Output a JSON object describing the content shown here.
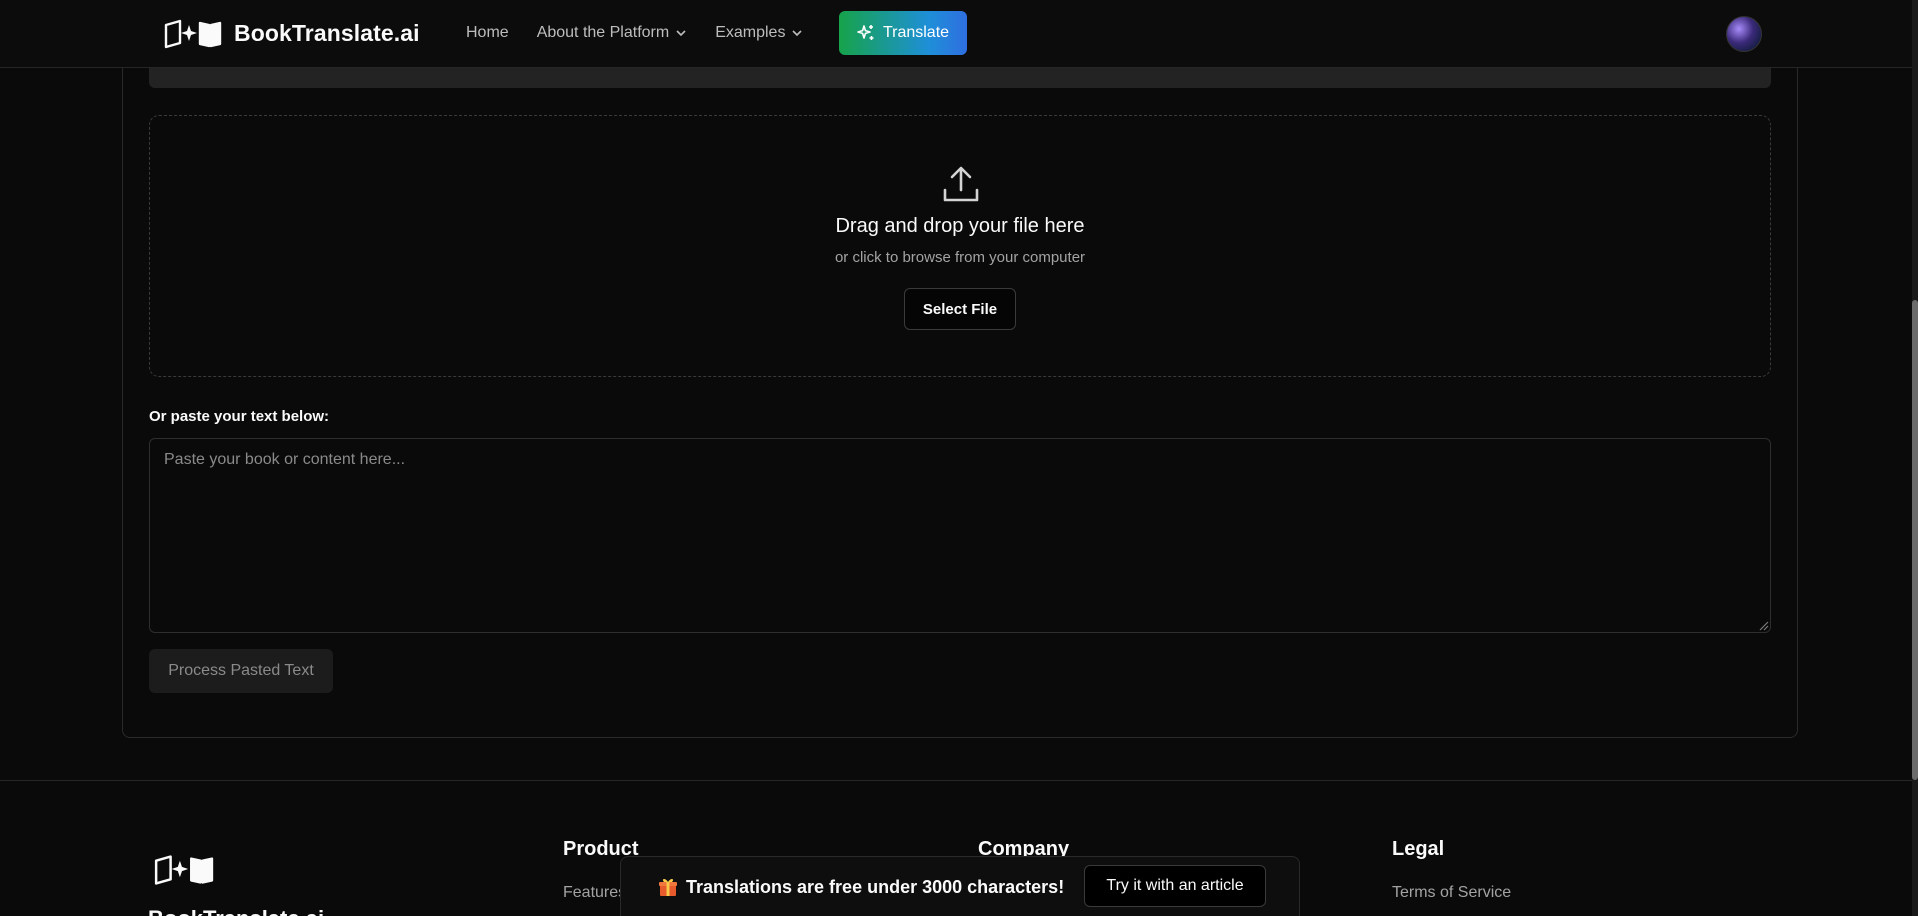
{
  "header": {
    "brand_name": "BookTranslate.ai",
    "nav": [
      {
        "label": "Home",
        "has_dropdown": false
      },
      {
        "label": "About the Platform",
        "has_dropdown": true
      },
      {
        "label": "Examples",
        "has_dropdown": true
      }
    ],
    "translate_label": "Translate"
  },
  "upload": {
    "title": "Drag and drop your file here",
    "subtitle": "or click to browse from your computer",
    "select_label": "Select File"
  },
  "paste": {
    "label": "Or paste your text below:",
    "placeholder": "Paste your book or content here...",
    "value": "",
    "process_label": "Process Pasted Text"
  },
  "footer": {
    "brand_name": "BookTranslate.ai",
    "columns": [
      {
        "heading": "Product",
        "first_link": "Features"
      },
      {
        "heading": "Company",
        "first_link": ""
      },
      {
        "heading": "Legal",
        "first_link": "Terms of Service"
      }
    ]
  },
  "promo": {
    "text": "Translations are free under 3000 characters!",
    "button_label": "Try it with an article",
    "icon": "gift-icon"
  },
  "colors": {
    "background": "#0a0a0a",
    "translate_gradient_start": "#16a34a",
    "translate_gradient_end": "#2f6fe0",
    "muted_text": "#a3a3a3"
  }
}
